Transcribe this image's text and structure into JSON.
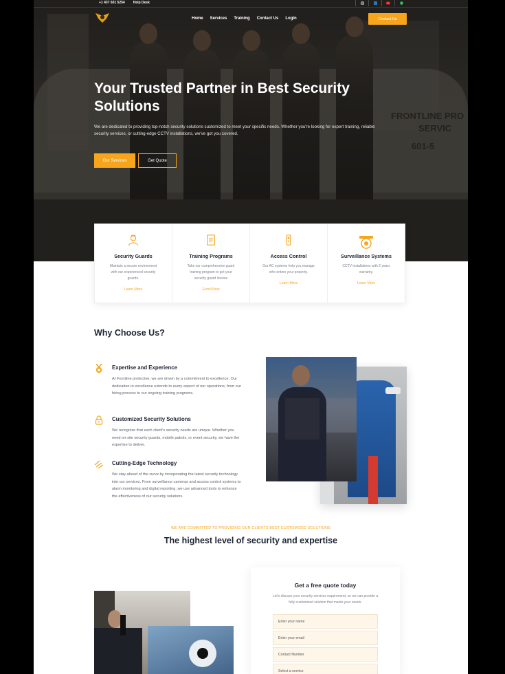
{
  "topbar": {
    "phone": "+1 437 601 5254",
    "helpdesk": "Help Desk"
  },
  "social": [
    "instagram-icon",
    "linkedin-icon",
    "youtube-icon",
    "whatsapp-icon"
  ],
  "nav": {
    "items": [
      "Home",
      "Services",
      "Training",
      "Contact Us",
      "Login"
    ],
    "cta": "Contact Us"
  },
  "hero": {
    "title": "Your Trusted Partner in Best Security Solutions",
    "description": "We are dedicated to providing top-notch security solutions customized to meet your specific needs. Whether you're looking for expert training, reliable security services, or cutting-edge CCTV installations, we've got you covered.",
    "btn_services": "Our Services",
    "btn_quote": "Get Quote",
    "van_text_1": "FRONTLINE PRO",
    "van_text_2": "SERVIC",
    "van_number": "601-5"
  },
  "services": [
    {
      "icon": "guard-icon",
      "title": "Security Guards",
      "desc": "Maintain a secure environment with our experienced security guards.",
      "link": "Learn More"
    },
    {
      "icon": "document-icon",
      "title": "Training Programs",
      "desc": "Take our comprehensive guard training program to get your security guard license",
      "link": "Enroll Now"
    },
    {
      "icon": "access-control-icon",
      "title": "Access Control",
      "desc": "Our AC systems help you manage who enters your property.",
      "link": "Learn More"
    },
    {
      "icon": "cctv-camera-icon",
      "title": "Surveillance Systems",
      "desc": "CCTV installations with 2 years warranty.",
      "link": "Learn More"
    }
  ],
  "why": {
    "title": "Why Choose Us?",
    "features": [
      {
        "icon": "medal-icon",
        "title": "Expertise and Experience",
        "desc": "At Frontline protective, we are driven by a commitment to excellence. Our dedication to excellence extends to every aspect of our operations, from our hiring process to our ongoing training programs."
      },
      {
        "icon": "lock-icon",
        "title": "Customized Security Solutions",
        "desc": "We recognize that each client's security needs are unique. Whether you need on-site security guards, mobile patrols, or event security, we have the expertise to deliver."
      },
      {
        "icon": "satellite-icon",
        "title": "Cutting-Edge Technology",
        "desc": "We stay ahead of the curve by incorporating the latest security technology into our services. From surveillance cameras and access control systems to alarm monitoring and digital reporting, we use advanced tools to enhance the effectiveness of our security solutions."
      }
    ]
  },
  "commitment": {
    "tagline": "WE ARE COMMITTED TO PROVIDING OUR CLIENTS BEST CUSTOMIZED SOLUTIONS",
    "title": "The highest level of security and expertise"
  },
  "quote_form": {
    "title": "Get a free quote today",
    "desc": "Let's discuss your security services requirement, so we can provide a fully customized solution that meets your needs.",
    "name_placeholder": "Enter your name",
    "email_placeholder": "Enter your email",
    "phone_placeholder": "Contact Number",
    "service_placeholder": "Select a service"
  },
  "colors": {
    "accent": "#f6a51c",
    "dark": "#1f2433"
  }
}
